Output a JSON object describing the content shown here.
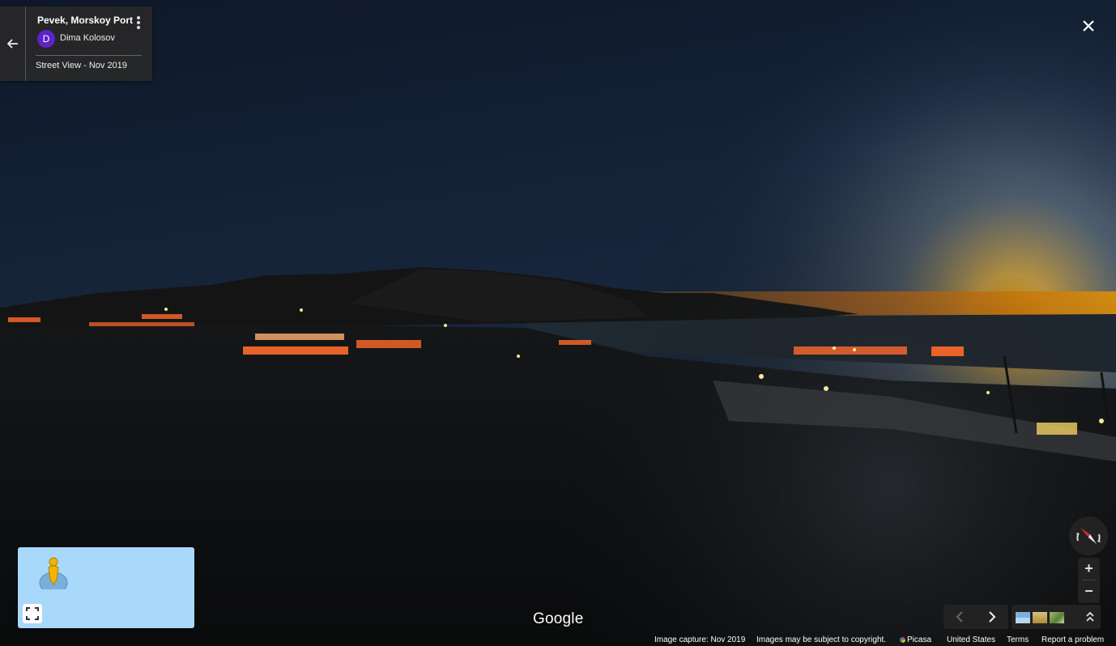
{
  "info_card": {
    "title": "Pevek, Morskoy Port",
    "author_initial": "D",
    "author_name": "Dima Kolosov",
    "date_label": "Street View - Nov 2019"
  },
  "map_logo": "Google",
  "footer": {
    "capture": "Image capture: Nov 2019",
    "copyright": "Images may be subject to copyright.",
    "picasa": "Picasa",
    "region": "United States",
    "terms": "Terms",
    "report": "Report a problem"
  },
  "icons": {
    "back": "arrow-left-icon",
    "more": "more-vert-icon",
    "close": "close-icon",
    "pegman": "pegman-icon",
    "expand": "fullscreen-icon",
    "compass": "compass-icon",
    "zoom_in": "plus-icon",
    "zoom_out": "minus-icon",
    "prev": "chevron-left-icon",
    "next": "chevron-right-icon",
    "collapse": "chevron-up-double-icon"
  },
  "colors": {
    "avatar": "#5e22c6",
    "card_bg": "#282828",
    "minimap_bg": "#a8d8fa",
    "compass_red": "#d32f2f"
  },
  "zoom_labels": {
    "in": "+",
    "out": "−"
  }
}
